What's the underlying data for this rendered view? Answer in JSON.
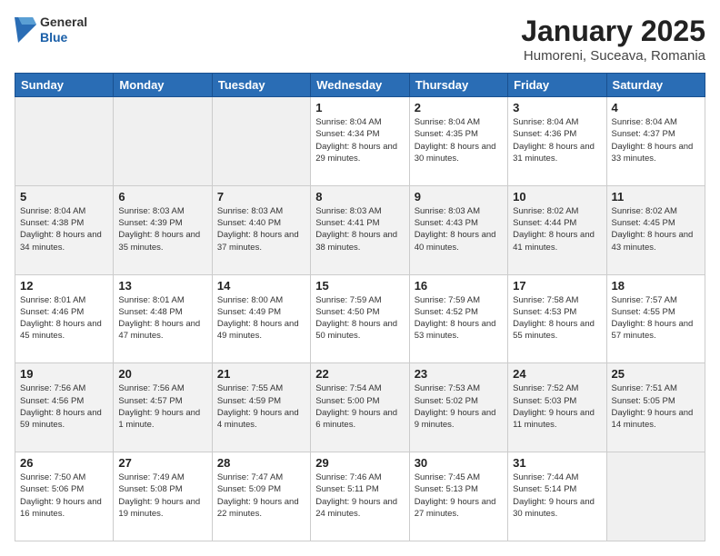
{
  "header": {
    "logo_general": "General",
    "logo_blue": "Blue",
    "title": "January 2025",
    "subtitle": "Humoreni, Suceava, Romania"
  },
  "days_of_week": [
    "Sunday",
    "Monday",
    "Tuesday",
    "Wednesday",
    "Thursday",
    "Friday",
    "Saturday"
  ],
  "weeks": [
    [
      {
        "day": "",
        "info": ""
      },
      {
        "day": "",
        "info": ""
      },
      {
        "day": "",
        "info": ""
      },
      {
        "day": "1",
        "info": "Sunrise: 8:04 AM\nSunset: 4:34 PM\nDaylight: 8 hours and 29 minutes."
      },
      {
        "day": "2",
        "info": "Sunrise: 8:04 AM\nSunset: 4:35 PM\nDaylight: 8 hours and 30 minutes."
      },
      {
        "day": "3",
        "info": "Sunrise: 8:04 AM\nSunset: 4:36 PM\nDaylight: 8 hours and 31 minutes."
      },
      {
        "day": "4",
        "info": "Sunrise: 8:04 AM\nSunset: 4:37 PM\nDaylight: 8 hours and 33 minutes."
      }
    ],
    [
      {
        "day": "5",
        "info": "Sunrise: 8:04 AM\nSunset: 4:38 PM\nDaylight: 8 hours and 34 minutes."
      },
      {
        "day": "6",
        "info": "Sunrise: 8:03 AM\nSunset: 4:39 PM\nDaylight: 8 hours and 35 minutes."
      },
      {
        "day": "7",
        "info": "Sunrise: 8:03 AM\nSunset: 4:40 PM\nDaylight: 8 hours and 37 minutes."
      },
      {
        "day": "8",
        "info": "Sunrise: 8:03 AM\nSunset: 4:41 PM\nDaylight: 8 hours and 38 minutes."
      },
      {
        "day": "9",
        "info": "Sunrise: 8:03 AM\nSunset: 4:43 PM\nDaylight: 8 hours and 40 minutes."
      },
      {
        "day": "10",
        "info": "Sunrise: 8:02 AM\nSunset: 4:44 PM\nDaylight: 8 hours and 41 minutes."
      },
      {
        "day": "11",
        "info": "Sunrise: 8:02 AM\nSunset: 4:45 PM\nDaylight: 8 hours and 43 minutes."
      }
    ],
    [
      {
        "day": "12",
        "info": "Sunrise: 8:01 AM\nSunset: 4:46 PM\nDaylight: 8 hours and 45 minutes."
      },
      {
        "day": "13",
        "info": "Sunrise: 8:01 AM\nSunset: 4:48 PM\nDaylight: 8 hours and 47 minutes."
      },
      {
        "day": "14",
        "info": "Sunrise: 8:00 AM\nSunset: 4:49 PM\nDaylight: 8 hours and 49 minutes."
      },
      {
        "day": "15",
        "info": "Sunrise: 7:59 AM\nSunset: 4:50 PM\nDaylight: 8 hours and 50 minutes."
      },
      {
        "day": "16",
        "info": "Sunrise: 7:59 AM\nSunset: 4:52 PM\nDaylight: 8 hours and 53 minutes."
      },
      {
        "day": "17",
        "info": "Sunrise: 7:58 AM\nSunset: 4:53 PM\nDaylight: 8 hours and 55 minutes."
      },
      {
        "day": "18",
        "info": "Sunrise: 7:57 AM\nSunset: 4:55 PM\nDaylight: 8 hours and 57 minutes."
      }
    ],
    [
      {
        "day": "19",
        "info": "Sunrise: 7:56 AM\nSunset: 4:56 PM\nDaylight: 8 hours and 59 minutes."
      },
      {
        "day": "20",
        "info": "Sunrise: 7:56 AM\nSunset: 4:57 PM\nDaylight: 9 hours and 1 minute."
      },
      {
        "day": "21",
        "info": "Sunrise: 7:55 AM\nSunset: 4:59 PM\nDaylight: 9 hours and 4 minutes."
      },
      {
        "day": "22",
        "info": "Sunrise: 7:54 AM\nSunset: 5:00 PM\nDaylight: 9 hours and 6 minutes."
      },
      {
        "day": "23",
        "info": "Sunrise: 7:53 AM\nSunset: 5:02 PM\nDaylight: 9 hours and 9 minutes."
      },
      {
        "day": "24",
        "info": "Sunrise: 7:52 AM\nSunset: 5:03 PM\nDaylight: 9 hours and 11 minutes."
      },
      {
        "day": "25",
        "info": "Sunrise: 7:51 AM\nSunset: 5:05 PM\nDaylight: 9 hours and 14 minutes."
      }
    ],
    [
      {
        "day": "26",
        "info": "Sunrise: 7:50 AM\nSunset: 5:06 PM\nDaylight: 9 hours and 16 minutes."
      },
      {
        "day": "27",
        "info": "Sunrise: 7:49 AM\nSunset: 5:08 PM\nDaylight: 9 hours and 19 minutes."
      },
      {
        "day": "28",
        "info": "Sunrise: 7:47 AM\nSunset: 5:09 PM\nDaylight: 9 hours and 22 minutes."
      },
      {
        "day": "29",
        "info": "Sunrise: 7:46 AM\nSunset: 5:11 PM\nDaylight: 9 hours and 24 minutes."
      },
      {
        "day": "30",
        "info": "Sunrise: 7:45 AM\nSunset: 5:13 PM\nDaylight: 9 hours and 27 minutes."
      },
      {
        "day": "31",
        "info": "Sunrise: 7:44 AM\nSunset: 5:14 PM\nDaylight: 9 hours and 30 minutes."
      },
      {
        "day": "",
        "info": ""
      }
    ]
  ]
}
